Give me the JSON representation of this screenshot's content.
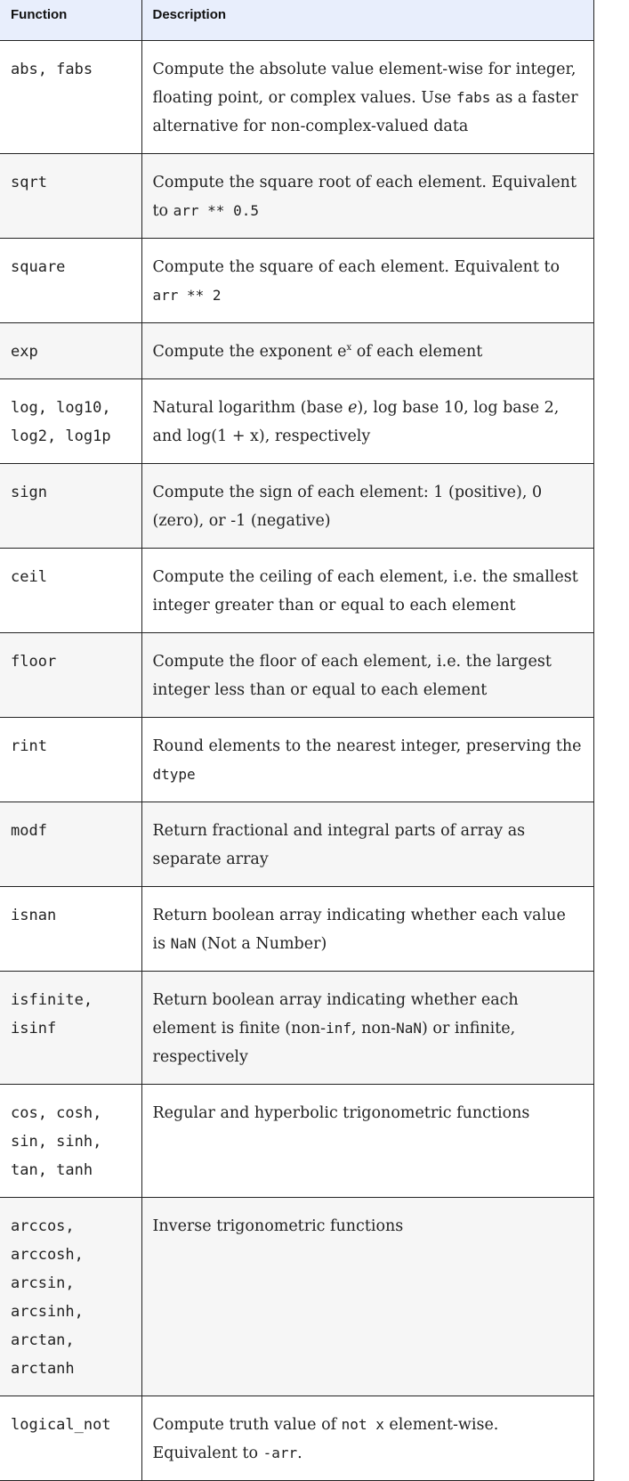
{
  "header": {
    "function": "Function",
    "description": "Description"
  },
  "rows": [
    {
      "fn": "abs, fabs",
      "desc": [
        {
          "t": "Compute the absolute value element-wise for integer, floating point, or complex values. Use "
        },
        {
          "t": "fabs",
          "c": 1
        },
        {
          "t": " as a faster alternative for non-complex-valued data"
        }
      ]
    },
    {
      "fn": "sqrt",
      "desc": [
        {
          "t": "Compute the square root of each element. Equivalent to "
        },
        {
          "t": "arr ** 0.5",
          "c": 1
        }
      ]
    },
    {
      "fn": "square",
      "desc": [
        {
          "t": "Compute the square of each element. Equivalent to "
        },
        {
          "t": "arr ** 2",
          "c": 1
        }
      ]
    },
    {
      "fn": "exp",
      "desc": [
        {
          "t": "Compute the exponent e"
        },
        {
          "t": "x",
          "s": 1
        },
        {
          "t": " of each element"
        }
      ]
    },
    {
      "fn": "log, log10,\nlog2, log1p",
      "desc": [
        {
          "t": "Natural logarithm (base "
        },
        {
          "t": "e",
          "i": 1
        },
        {
          "t": "), log base 10, log base 2, and log(1 + x), respectively"
        }
      ]
    },
    {
      "fn": "sign",
      "desc": [
        {
          "t": "Compute the sign of each element: 1 (positive), 0 (zero), or -1 (negative)"
        }
      ]
    },
    {
      "fn": "ceil",
      "desc": [
        {
          "t": "Compute the ceiling of each element, i.e. the smallest integer greater than or equal to each element"
        }
      ]
    },
    {
      "fn": "floor",
      "desc": [
        {
          "t": "Compute the floor of each element, i.e. the largest integer less than or equal to each element"
        }
      ]
    },
    {
      "fn": "rint",
      "desc": [
        {
          "t": "Round elements to the nearest integer, preserving the "
        },
        {
          "t": "dtype",
          "c": 1
        }
      ]
    },
    {
      "fn": "modf",
      "desc": [
        {
          "t": "Return fractional and integral parts of array as separate array"
        }
      ]
    },
    {
      "fn": "isnan",
      "desc": [
        {
          "t": "Return boolean array indicating whether each value is "
        },
        {
          "t": "NaN",
          "c": 1
        },
        {
          "t": " (Not a Number)"
        }
      ]
    },
    {
      "fn": "isfinite,\nisinf",
      "desc": [
        {
          "t": "Return boolean array indicating whether each element is finite (non-"
        },
        {
          "t": "inf",
          "c": 1
        },
        {
          "t": ", non-"
        },
        {
          "t": "NaN",
          "c": 1
        },
        {
          "t": ") or infinite, respectively"
        }
      ]
    },
    {
      "fn": "cos, cosh,\nsin, sinh,\ntan, tanh",
      "desc": [
        {
          "t": "Regular and hyperbolic trigonometric functions"
        }
      ]
    },
    {
      "fn": "arccos,\narccosh,\narcsin,\narcsinh,\narctan,\narctanh",
      "desc": [
        {
          "t": "Inverse trigonometric functions"
        }
      ]
    },
    {
      "fn": "logical_not",
      "desc": [
        {
          "t": "Compute truth value of "
        },
        {
          "t": "not x",
          "c": 1
        },
        {
          "t": " element-wise. Equivalent to "
        },
        {
          "t": "-arr",
          "c": 1
        },
        {
          "t": "."
        }
      ]
    }
  ]
}
